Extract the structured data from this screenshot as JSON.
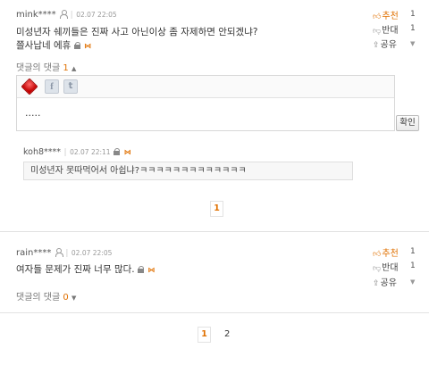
{
  "comment1": {
    "user": "mink****",
    "datetime": "02.07 22:05",
    "line1": "미성년자 쉐끼들은 진짜 사고 아닌이상 좀 자제하면 안되겠냐?",
    "line2": "쯜사납네 에휴",
    "recommend_label": "추천",
    "recommend_count": "1",
    "oppose_label": "반대",
    "oppose_count": "1",
    "share_label": "공유",
    "replies_label": "댓글의 댓글",
    "replies_count": "1",
    "replies_toggle": "▲"
  },
  "editor": {
    "text": ".....",
    "submit_label": "확인"
  },
  "reply1": {
    "user": "koh8****",
    "datetime": "02.07 22:11",
    "text": "미성년자 못따먹어서 아쉽냐?ㅋㅋㅋㅋㅋㅋㅋㅋㅋㅋㅋㅋㅋ"
  },
  "reply_pager": {
    "current": "1"
  },
  "comment2": {
    "user": "rain****",
    "datetime": "02.07 22:05",
    "text": "여자들 문제가 진짜 너무 많다.",
    "recommend_label": "추천",
    "recommend_count": "1",
    "oppose_label": "반대",
    "oppose_count": "1",
    "share_label": "공유",
    "replies_label": "댓글의 댓글",
    "replies_count": "0",
    "replies_toggle": "▼"
  },
  "pager": {
    "current": "1",
    "next": "2"
  },
  "icons": {
    "person": "person-icon",
    "lock": "lock-icon",
    "report": "report-icon",
    "thumb_up": "thumb-up-icon",
    "thumb_down": "thumb-down-icon",
    "share": "share-icon"
  },
  "colors": {
    "accent": "#e07000",
    "text": "#333333",
    "border": "#e2e2e2"
  }
}
